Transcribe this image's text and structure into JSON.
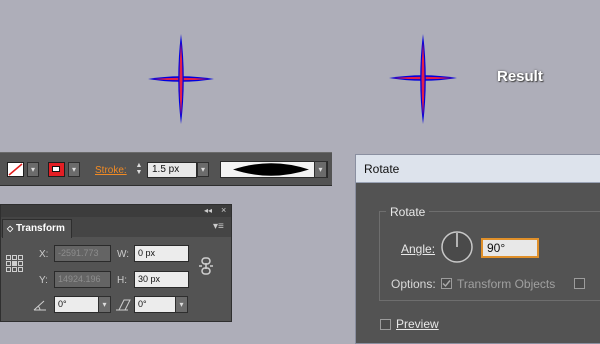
{
  "canvas": {
    "result_label": "Result",
    "colors": {
      "outline": "#0000e0",
      "fill": "#e2204a",
      "background": "#aeaeb9"
    }
  },
  "control_bar": {
    "stroke_label": "Stroke:",
    "stroke_weight": "1.5 px",
    "icons": [
      "no-fill-swatch-icon",
      "stroke-swatch-icon",
      "spinner-icon",
      "width-profile-icon"
    ]
  },
  "transform_panel": {
    "tab_label": "Transform",
    "x_label": "X:",
    "x_value": "-2591.773",
    "y_label": "Y:",
    "y_value": "14924.196",
    "w_label": "W:",
    "w_value": "0 px",
    "h_label": "H:",
    "h_value": "30 px",
    "rotate_value": "0°",
    "shear_value": "0°",
    "icons": [
      "reference-point-icon",
      "constrain-link-icon",
      "rotate-angle-icon",
      "shear-angle-icon"
    ]
  },
  "rotate_dialog": {
    "title": "Rotate",
    "group_label": "Rotate",
    "angle_label": "Angle:",
    "angle_value": "90°",
    "options_label": "Options:",
    "transform_objects_label": "Transform Objects",
    "preview_label": "Preview",
    "accent_color": "#e0902a"
  }
}
